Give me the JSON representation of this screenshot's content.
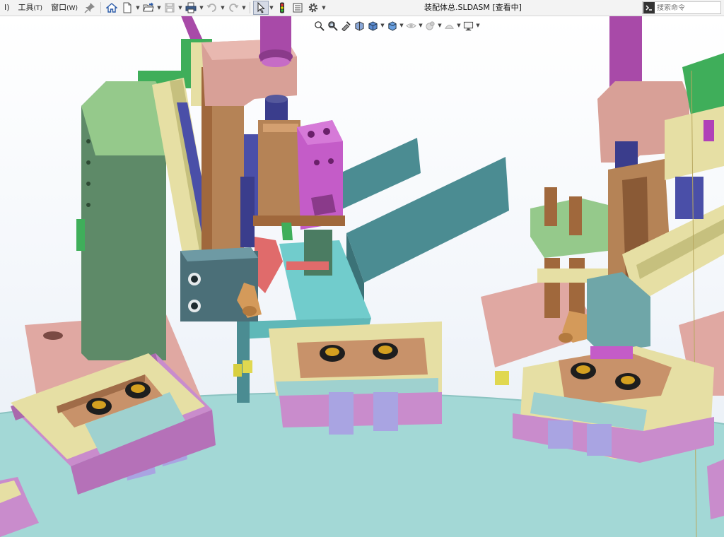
{
  "menubar": {
    "items": [
      {
        "label": "I)",
        "id": "first"
      },
      {
        "label": "工具",
        "accel": "(T)",
        "id": "tools"
      },
      {
        "label": "窗口",
        "accel": "(W)",
        "id": "window"
      }
    ]
  },
  "toolbar": {
    "icons": [
      "pin-icon",
      "home-icon",
      "new-document-icon",
      "open-folder-icon",
      "save-icon",
      "print-icon",
      "undo-icon",
      "redo-icon",
      "select-arrow-icon",
      "traffic-light-icon",
      "options-list-icon",
      "gear-icon"
    ]
  },
  "document": {
    "title": "装配体总.SLDASM [查看中]"
  },
  "search": {
    "placeholder": "搜索命令"
  },
  "heads_up_toolbar": {
    "icons": [
      "zoom-to-fit-icon",
      "zoom-area-icon",
      "previous-view-icon",
      "section-view-icon",
      "view-orientation-icon",
      "display-style-icon",
      "hide-show-icon",
      "appearance-icon",
      "scene-icon",
      "display-monitor-icon"
    ]
  },
  "colors": {
    "platform_cyan": "#a3d8d6",
    "salmon_plate": "#e0a8a2",
    "mold_yellow": "#e6dfa4",
    "copper_strip": "#c8926a",
    "lilac_base": "#c98ccc",
    "lavender_block": "#a9a4e2",
    "magenta_cylinder": "#a84aa8",
    "dark_green_column": "#5e8a68",
    "light_green_column": "#95c98b",
    "navy_block": "#4a4fa8",
    "teal_chute": "#4b8c92",
    "brown_block": "#b58356",
    "rose_block": "#d8a097"
  }
}
